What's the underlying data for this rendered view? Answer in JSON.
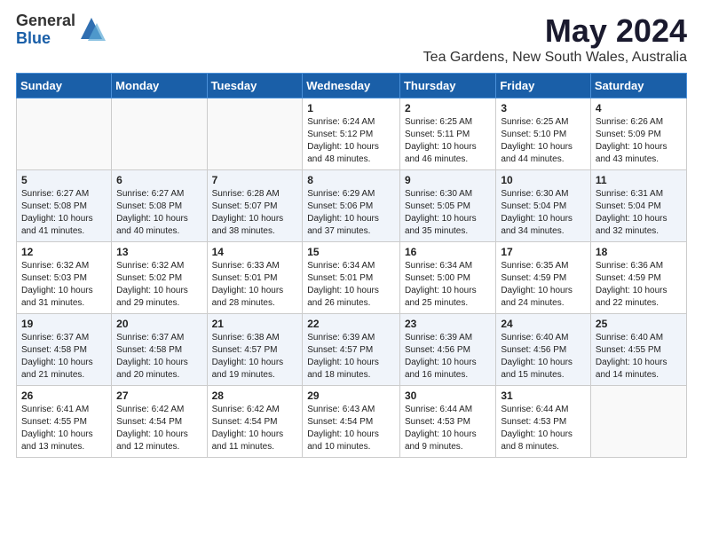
{
  "logo": {
    "general": "General",
    "blue": "Blue"
  },
  "title": "May 2024",
  "subtitle": "Tea Gardens, New South Wales, Australia",
  "days": [
    "Sunday",
    "Monday",
    "Tuesday",
    "Wednesday",
    "Thursday",
    "Friday",
    "Saturday"
  ],
  "weeks": [
    [
      {
        "day": "",
        "content": ""
      },
      {
        "day": "",
        "content": ""
      },
      {
        "day": "",
        "content": ""
      },
      {
        "day": "1",
        "content": "Sunrise: 6:24 AM\nSunset: 5:12 PM\nDaylight: 10 hours\nand 48 minutes."
      },
      {
        "day": "2",
        "content": "Sunrise: 6:25 AM\nSunset: 5:11 PM\nDaylight: 10 hours\nand 46 minutes."
      },
      {
        "day": "3",
        "content": "Sunrise: 6:25 AM\nSunset: 5:10 PM\nDaylight: 10 hours\nand 44 minutes."
      },
      {
        "day": "4",
        "content": "Sunrise: 6:26 AM\nSunset: 5:09 PM\nDaylight: 10 hours\nand 43 minutes."
      }
    ],
    [
      {
        "day": "5",
        "content": "Sunrise: 6:27 AM\nSunset: 5:08 PM\nDaylight: 10 hours\nand 41 minutes."
      },
      {
        "day": "6",
        "content": "Sunrise: 6:27 AM\nSunset: 5:08 PM\nDaylight: 10 hours\nand 40 minutes."
      },
      {
        "day": "7",
        "content": "Sunrise: 6:28 AM\nSunset: 5:07 PM\nDaylight: 10 hours\nand 38 minutes."
      },
      {
        "day": "8",
        "content": "Sunrise: 6:29 AM\nSunset: 5:06 PM\nDaylight: 10 hours\nand 37 minutes."
      },
      {
        "day": "9",
        "content": "Sunrise: 6:30 AM\nSunset: 5:05 PM\nDaylight: 10 hours\nand 35 minutes."
      },
      {
        "day": "10",
        "content": "Sunrise: 6:30 AM\nSunset: 5:04 PM\nDaylight: 10 hours\nand 34 minutes."
      },
      {
        "day": "11",
        "content": "Sunrise: 6:31 AM\nSunset: 5:04 PM\nDaylight: 10 hours\nand 32 minutes."
      }
    ],
    [
      {
        "day": "12",
        "content": "Sunrise: 6:32 AM\nSunset: 5:03 PM\nDaylight: 10 hours\nand 31 minutes."
      },
      {
        "day": "13",
        "content": "Sunrise: 6:32 AM\nSunset: 5:02 PM\nDaylight: 10 hours\nand 29 minutes."
      },
      {
        "day": "14",
        "content": "Sunrise: 6:33 AM\nSunset: 5:01 PM\nDaylight: 10 hours\nand 28 minutes."
      },
      {
        "day": "15",
        "content": "Sunrise: 6:34 AM\nSunset: 5:01 PM\nDaylight: 10 hours\nand 26 minutes."
      },
      {
        "day": "16",
        "content": "Sunrise: 6:34 AM\nSunset: 5:00 PM\nDaylight: 10 hours\nand 25 minutes."
      },
      {
        "day": "17",
        "content": "Sunrise: 6:35 AM\nSunset: 4:59 PM\nDaylight: 10 hours\nand 24 minutes."
      },
      {
        "day": "18",
        "content": "Sunrise: 6:36 AM\nSunset: 4:59 PM\nDaylight: 10 hours\nand 22 minutes."
      }
    ],
    [
      {
        "day": "19",
        "content": "Sunrise: 6:37 AM\nSunset: 4:58 PM\nDaylight: 10 hours\nand 21 minutes."
      },
      {
        "day": "20",
        "content": "Sunrise: 6:37 AM\nSunset: 4:58 PM\nDaylight: 10 hours\nand 20 minutes."
      },
      {
        "day": "21",
        "content": "Sunrise: 6:38 AM\nSunset: 4:57 PM\nDaylight: 10 hours\nand 19 minutes."
      },
      {
        "day": "22",
        "content": "Sunrise: 6:39 AM\nSunset: 4:57 PM\nDaylight: 10 hours\nand 18 minutes."
      },
      {
        "day": "23",
        "content": "Sunrise: 6:39 AM\nSunset: 4:56 PM\nDaylight: 10 hours\nand 16 minutes."
      },
      {
        "day": "24",
        "content": "Sunrise: 6:40 AM\nSunset: 4:56 PM\nDaylight: 10 hours\nand 15 minutes."
      },
      {
        "day": "25",
        "content": "Sunrise: 6:40 AM\nSunset: 4:55 PM\nDaylight: 10 hours\nand 14 minutes."
      }
    ],
    [
      {
        "day": "26",
        "content": "Sunrise: 6:41 AM\nSunset: 4:55 PM\nDaylight: 10 hours\nand 13 minutes."
      },
      {
        "day": "27",
        "content": "Sunrise: 6:42 AM\nSunset: 4:54 PM\nDaylight: 10 hours\nand 12 minutes."
      },
      {
        "day": "28",
        "content": "Sunrise: 6:42 AM\nSunset: 4:54 PM\nDaylight: 10 hours\nand 11 minutes."
      },
      {
        "day": "29",
        "content": "Sunrise: 6:43 AM\nSunset: 4:54 PM\nDaylight: 10 hours\nand 10 minutes."
      },
      {
        "day": "30",
        "content": "Sunrise: 6:44 AM\nSunset: 4:53 PM\nDaylight: 10 hours\nand 9 minutes."
      },
      {
        "day": "31",
        "content": "Sunrise: 6:44 AM\nSunset: 4:53 PM\nDaylight: 10 hours\nand 8 minutes."
      },
      {
        "day": "",
        "content": ""
      }
    ]
  ]
}
